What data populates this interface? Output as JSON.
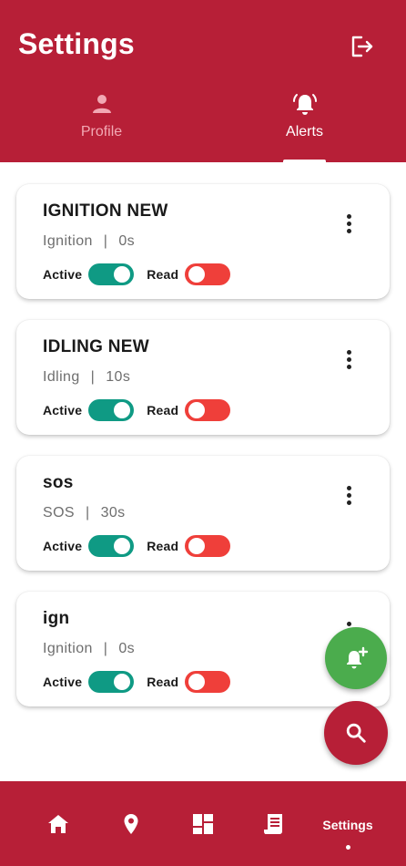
{
  "header": {
    "title": "Settings",
    "logout_icon": "logout-icon",
    "bg_color": "#b71f37"
  },
  "tabs": [
    {
      "label": "Profile",
      "icon": "person-icon",
      "active": false
    },
    {
      "label": "Alerts",
      "icon": "bell-ring-icon",
      "active": true
    }
  ],
  "alerts": [
    {
      "title": "IGNITION NEW",
      "type": "Ignition",
      "separator": "|",
      "duration": "0s",
      "active_label": "Active",
      "active_on": true,
      "read_label": "Read",
      "read_on": false
    },
    {
      "title": "IDLING NEW",
      "type": "Idling",
      "separator": "|",
      "duration": "10s",
      "active_label": "Active",
      "active_on": true,
      "read_label": "Read",
      "read_on": false
    },
    {
      "title": "sos",
      "type": "SOS",
      "separator": "|",
      "duration": "30s",
      "active_label": "Active",
      "active_on": true,
      "read_label": "Read",
      "read_on": false
    },
    {
      "title": "ign",
      "type": "Ignition",
      "separator": "|",
      "duration": "0s",
      "active_label": "Active",
      "active_on": true,
      "read_label": "Read",
      "read_on": false
    }
  ],
  "fabs": {
    "add_alert_icon": "add-alert-icon",
    "search_icon": "search-icon"
  },
  "bottom_nav": {
    "items": [
      {
        "icon": "home-icon"
      },
      {
        "icon": "location-pin-icon"
      },
      {
        "icon": "dashboard-icon"
      },
      {
        "icon": "report-icon"
      }
    ],
    "active_label": "Settings"
  },
  "colors": {
    "primary": "#b71f37",
    "toggle_on": "#0f9a84",
    "toggle_off": "#ef3f3a",
    "fab_add": "#4bac4d"
  }
}
